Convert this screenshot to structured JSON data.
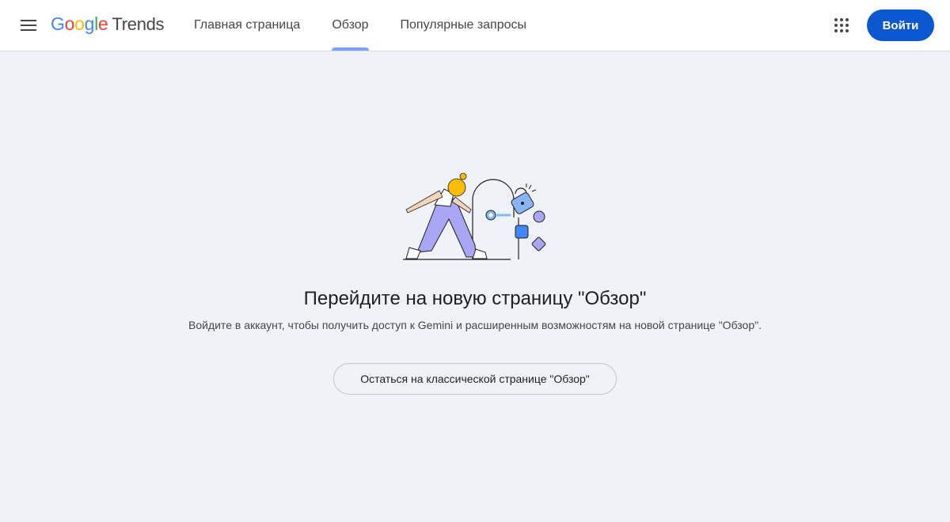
{
  "header": {
    "logo": {
      "letters": [
        {
          "char": "G",
          "color": "#4285F4"
        },
        {
          "char": "o",
          "color": "#EA4335"
        },
        {
          "char": "o",
          "color": "#FBBC04"
        },
        {
          "char": "g",
          "color": "#4285F4"
        },
        {
          "char": "l",
          "color": "#34A853"
        },
        {
          "char": "e",
          "color": "#EA4335"
        }
      ],
      "product": "Trends"
    },
    "nav": [
      {
        "label": "Главная страница",
        "active": false
      },
      {
        "label": "Обзор",
        "active": true
      },
      {
        "label": "Популярные запросы",
        "active": false
      }
    ],
    "signin_label": "Войти"
  },
  "icons": {
    "menu": "hamburger-menu-icon",
    "apps": "apps-grid-icon"
  },
  "main": {
    "title": "Перейдите на новую страницу \"Обзор\"",
    "subtitle": "Войдите в аккаунт, чтобы получить доступ к Gemini и расширенным возможностям на новой странице \"Обзор\".",
    "classic_button_label": "Остаться на классической странице \"Обзор\""
  },
  "colors": {
    "primary": "#0b57d0",
    "active_tab": "#7aa2f7",
    "background": "#eff3f8",
    "illustration_purple": "#a8a6f5",
    "illustration_blue": "#8ab4f8",
    "illustration_yellow": "#fbbc04"
  }
}
